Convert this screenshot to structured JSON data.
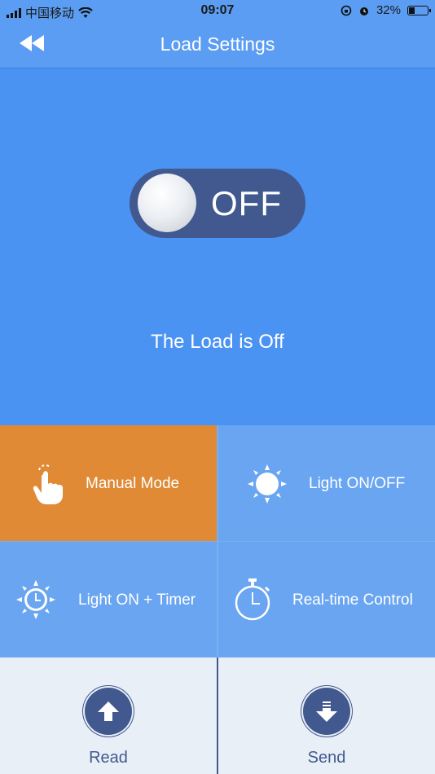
{
  "status_bar": {
    "carrier": "中国移动",
    "time": "09:07",
    "battery": "32%",
    "battery_level": 0.32
  },
  "nav": {
    "title": "Load Settings",
    "back_icon": "double-chevron-left-icon"
  },
  "toggle": {
    "state": "OFF",
    "on": false
  },
  "status": {
    "message": "The Load is Off"
  },
  "modes": [
    {
      "label": "Manual Mode",
      "icon": "hand-pointer-icon",
      "active": true
    },
    {
      "label": "Light ON/OFF",
      "icon": "sun-icon",
      "active": false
    },
    {
      "label": "Light ON + Timer",
      "icon": "sun-clock-icon",
      "active": false
    },
    {
      "label": "Real-time Control",
      "icon": "stopwatch-icon",
      "active": false
    }
  ],
  "actions": [
    {
      "label": "Read",
      "icon": "arrow-up-icon"
    },
    {
      "label": "Send",
      "icon": "arrow-down-icon"
    }
  ],
  "colors": {
    "primary": "#4b93f3",
    "active_tile": "#e08a35",
    "toggle_bg": "#41598f",
    "tile_bg": "#6aa5f1"
  }
}
